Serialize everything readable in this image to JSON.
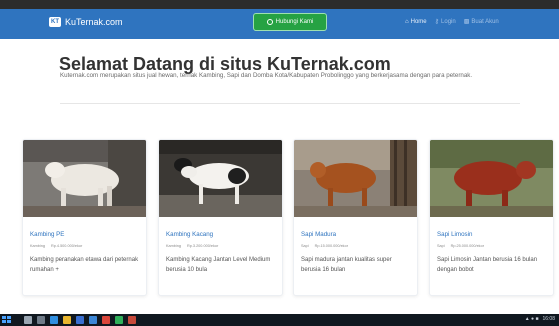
{
  "navbar": {
    "brand_logo": "KT",
    "brand_text": "KuTernak.com",
    "whatsapp_button": "Hubungi Kami",
    "links": [
      {
        "label": "Home",
        "icon": "home-icon"
      },
      {
        "label": "Login",
        "icon": "key-icon"
      },
      {
        "label": "Buat Akun",
        "icon": "user-plus-icon"
      }
    ],
    "colors": {
      "navbar": "#2f74bf",
      "whatsapp": "#26a243"
    }
  },
  "hero": {
    "title": "Selamat Datang di situs KuTernak.com",
    "description": "Kuternak.com merupakan situs jual hewan, ternak Kambing, Sapi dan Domba Kota/Kabupaten Probolinggo yang berkerjasama dengan para peternak."
  },
  "products": [
    {
      "name": "Kambing PE",
      "category": "Kambing",
      "price": "Rp.4.500.000/ekor",
      "description": "Kambing peranakan etawa dari peternak rumahan +"
    },
    {
      "name": "Kambing Kacang",
      "category": "Kambing",
      "price": "Rp.3.200.000/ekor",
      "description": "Kambing Kacang Jantan Level Medium berusia 10 bula"
    },
    {
      "name": "Sapi Madura",
      "category": "Sapi",
      "price": "Rp.15.000.000/ekor",
      "description": "Sapi madura jantan kualitas super berusia 16 bulan"
    },
    {
      "name": "Sapi Limosin",
      "category": "Sapi",
      "price": "Rp.25.000.000/ekor",
      "description": "Sapi Limosin Jantan berusia 16 bulan dengan bobot"
    }
  ],
  "taskbar": {
    "clock": "16:08"
  }
}
